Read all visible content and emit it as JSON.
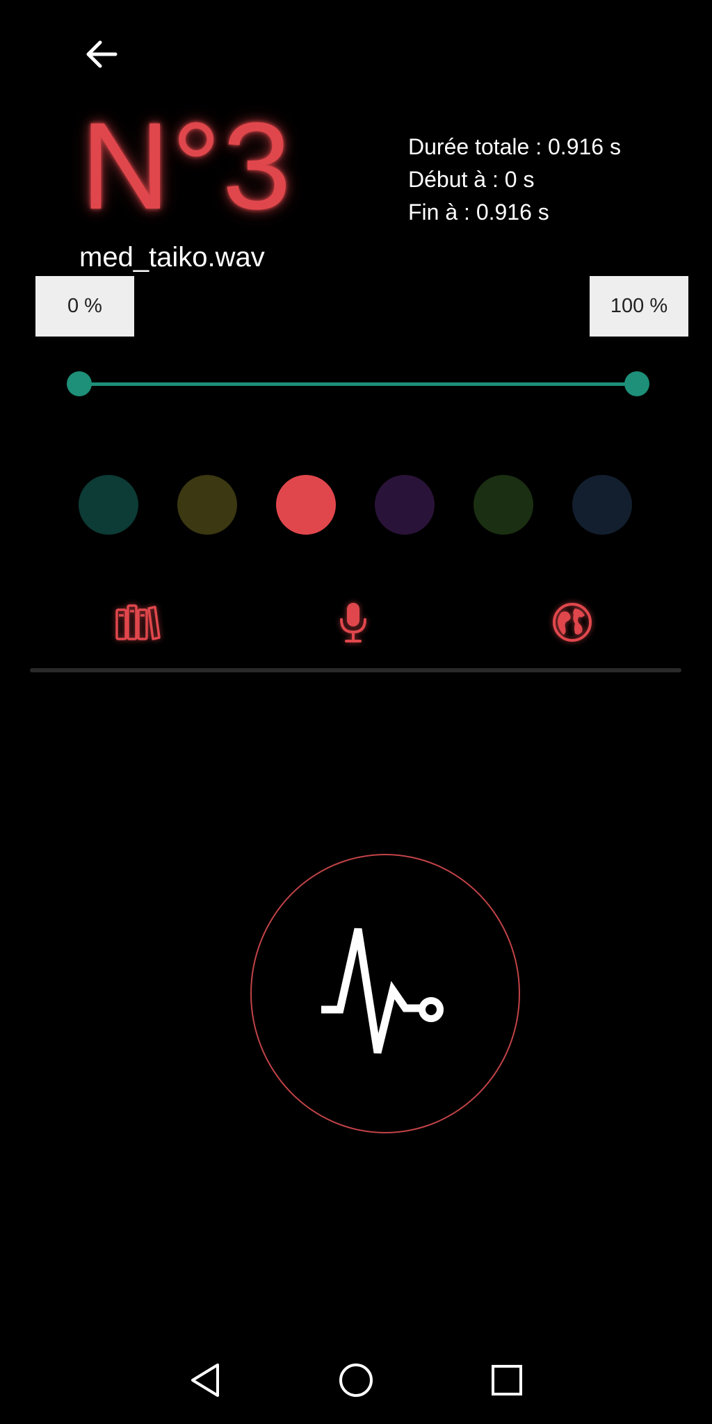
{
  "pad": {
    "number_label": "N°3",
    "file_name": "med_taiko.wav",
    "accent_color": "#e0474c"
  },
  "info": {
    "total_duration": "Durée totale : 0.916 s",
    "start_at": "Début à : 0 s",
    "end_at": "Fin à : 0.916 s"
  },
  "trim": {
    "start_percent_label": "0 %",
    "end_percent_label": "100 %",
    "start_fraction": 0,
    "end_fraction": 1,
    "slider_color": "#1e8f78"
  },
  "colors": {
    "swatches": [
      "#0d3b36",
      "#3b3812",
      "#e0474c",
      "#2a1338",
      "#1b2f12",
      "#131f2e"
    ],
    "selected_index": 2
  },
  "tabs": {
    "items": [
      "library-icon",
      "microphone-icon",
      "globe-icon"
    ]
  },
  "record": {
    "icon": "waveform-pulse-icon",
    "ring_color": "#c24348"
  },
  "nav": {
    "items": [
      "back-triangle-icon",
      "home-circle-icon",
      "recents-square-icon"
    ]
  }
}
